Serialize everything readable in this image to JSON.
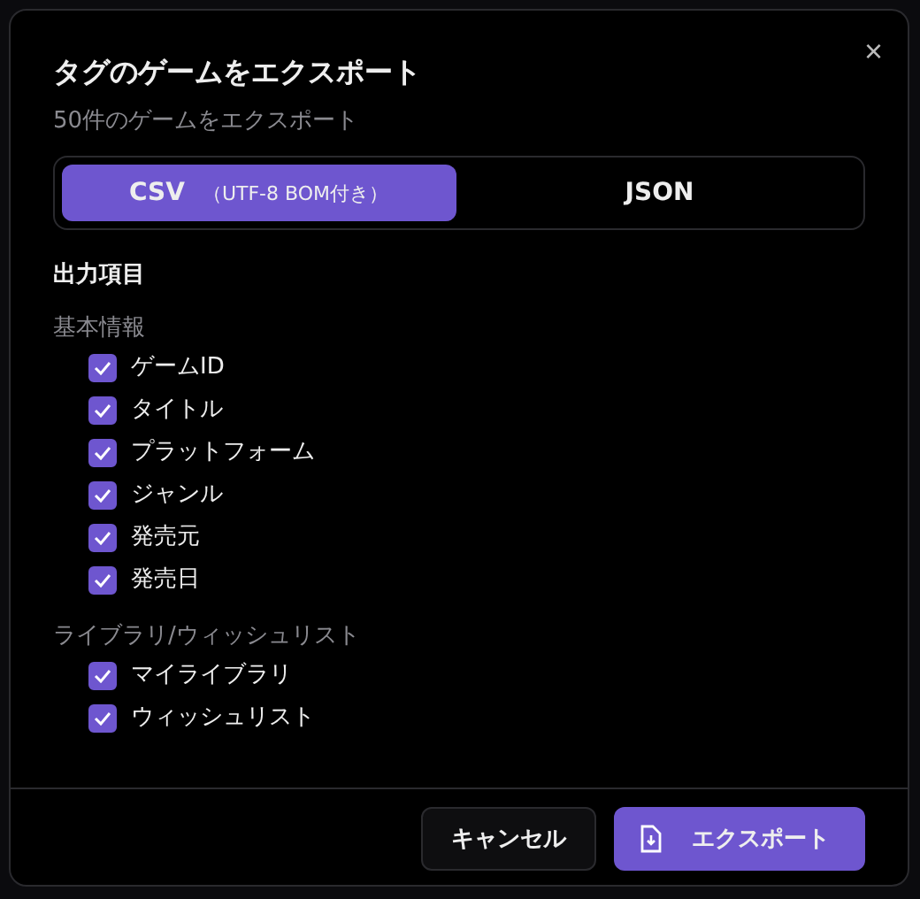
{
  "dialog": {
    "title": "タグのゲームをエクスポート",
    "subtitle": "50件のゲームをエクスポート",
    "close": "×",
    "formats": [
      {
        "label": "CSV",
        "note": "（UTF-8 BOM付き）",
        "selected": true
      },
      {
        "label": "JSON",
        "selected": false
      }
    ],
    "section_title": "出力項目",
    "groups": [
      {
        "label": "基本情報",
        "fields": [
          {
            "label": "ゲームID",
            "checked": true
          },
          {
            "label": "タイトル",
            "checked": true
          },
          {
            "label": "プラットフォーム",
            "checked": true
          },
          {
            "label": "ジャンル",
            "checked": true
          },
          {
            "label": "発売元",
            "checked": true
          },
          {
            "label": "発売日",
            "checked": true
          }
        ]
      },
      {
        "label": "ライブラリ/ウィッシュリスト",
        "fields": [
          {
            "label": "マイライブラリ",
            "checked": true
          },
          {
            "label": "ウィッシュリスト",
            "checked": true
          }
        ]
      }
    ],
    "buttons": [
      {
        "label": "キャンセル",
        "kind": "secondary"
      },
      {
        "label": "エクスポート",
        "kind": "primary"
      }
    ]
  }
}
